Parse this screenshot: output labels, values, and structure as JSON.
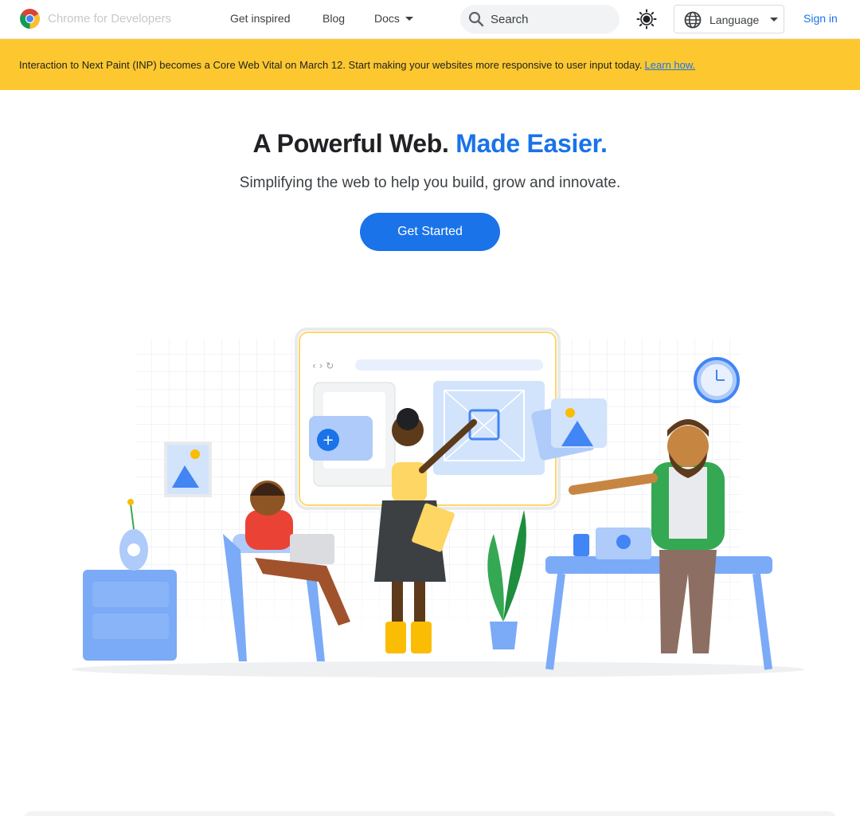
{
  "header": {
    "brand_name": "Chrome for Developers",
    "nav": {
      "get_inspired": "Get inspired",
      "blog": "Blog",
      "docs": "Docs"
    },
    "search": {
      "placeholder": "Search"
    },
    "language_label": "Language",
    "sign_in": "Sign in"
  },
  "banner": {
    "text": "Interaction to Next Paint (INP) becomes a Core Web Vital on March 12. Start making your websites more responsive to user input today.",
    "link": "Learn how."
  },
  "hero": {
    "title_part1": "A Powerful Web.",
    "title_part2": "Made Easier.",
    "subtitle": "Simplifying the web to help you build, grow and innovate.",
    "cta": "Get Started"
  },
  "icons": {
    "brand": "chrome-logo-icon",
    "search": "search-icon",
    "theme": "sun-icon",
    "language": "globe-icon",
    "dropdown": "caret-down-icon"
  },
  "colors": {
    "accent": "#1a73e8",
    "banner": "#fdc82f",
    "text": "#202124"
  }
}
